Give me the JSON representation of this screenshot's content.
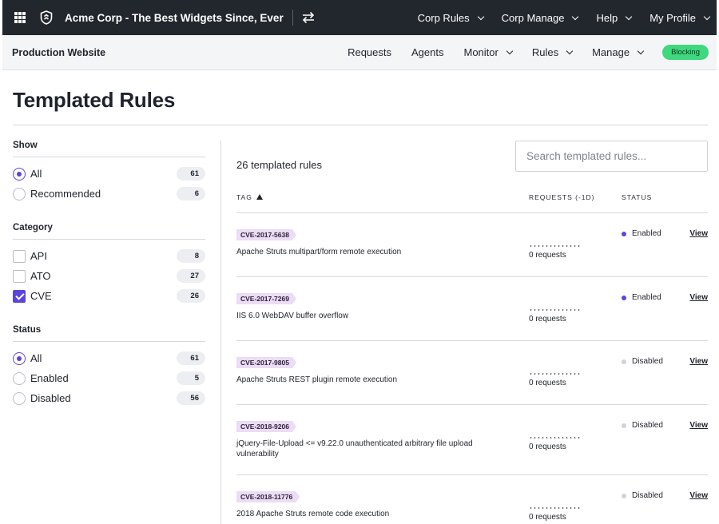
{
  "topbar": {
    "app_title": "Acme Corp - The Best Widgets Since, Ever",
    "nav": [
      {
        "label": "Corp Rules"
      },
      {
        "label": "Corp Manage"
      },
      {
        "label": "Help"
      },
      {
        "label": "My Profile"
      }
    ]
  },
  "subbar": {
    "site_name": "Production Website",
    "nav": [
      {
        "label": "Requests"
      },
      {
        "label": "Agents"
      },
      {
        "label": "Monitor"
      },
      {
        "label": "Rules"
      },
      {
        "label": "Manage"
      }
    ],
    "badge": "Blocking"
  },
  "page": {
    "title": "Templated Rules"
  },
  "filters": {
    "show": {
      "title": "Show",
      "options": [
        {
          "label": "All",
          "count": "61",
          "selected": true
        },
        {
          "label": "Recommended",
          "count": "6",
          "selected": false
        }
      ]
    },
    "category": {
      "title": "Category",
      "options": [
        {
          "label": "API",
          "count": "8",
          "checked": false
        },
        {
          "label": "ATO",
          "count": "27",
          "checked": false
        },
        {
          "label": "CVE",
          "count": "26",
          "checked": true
        }
      ]
    },
    "status": {
      "title": "Status",
      "options": [
        {
          "label": "All",
          "count": "61",
          "selected": true
        },
        {
          "label": "Enabled",
          "count": "5",
          "selected": false
        },
        {
          "label": "Disabled",
          "count": "56",
          "selected": false
        }
      ]
    }
  },
  "main": {
    "rules_count": "26 templated rules",
    "search_placeholder": "Search templated rules...",
    "columns": {
      "tag": "TAG",
      "requests": "REQUESTS (-1D)",
      "status": "STATUS"
    },
    "rows": [
      {
        "tag": "CVE-2017-5638",
        "desc": "Apache Struts multipart/form remote execution",
        "requests": "0 requests",
        "status": "Enabled",
        "view": "View"
      },
      {
        "tag": "CVE-2017-7269",
        "desc": "IIS 6.0 WebDAV buffer overflow",
        "requests": "0 requests",
        "status": "Enabled",
        "view": "View"
      },
      {
        "tag": "CVE-2017-9805",
        "desc": "Apache Struts REST plugin remote execution",
        "requests": "0 requests",
        "status": "Disabled",
        "view": "View"
      },
      {
        "tag": "CVE-2018-9206",
        "desc": "jQuery-File-Upload <= v9.22.0 unauthenticated arbitrary file upload vulnerability",
        "requests": "0 requests",
        "status": "Disabled",
        "view": "View"
      },
      {
        "tag": "CVE-2018-11776",
        "desc": "2018 Apache Struts remote code execution",
        "requests": "0 requests",
        "status": "Disabled",
        "view": "View"
      }
    ]
  },
  "colors": {
    "accent": "#5a45d8",
    "enabled_dot": "#5a45d8",
    "disabled_dot": "#d0d3d8",
    "badge": "#3fd87f",
    "topbar": "#22262d"
  }
}
